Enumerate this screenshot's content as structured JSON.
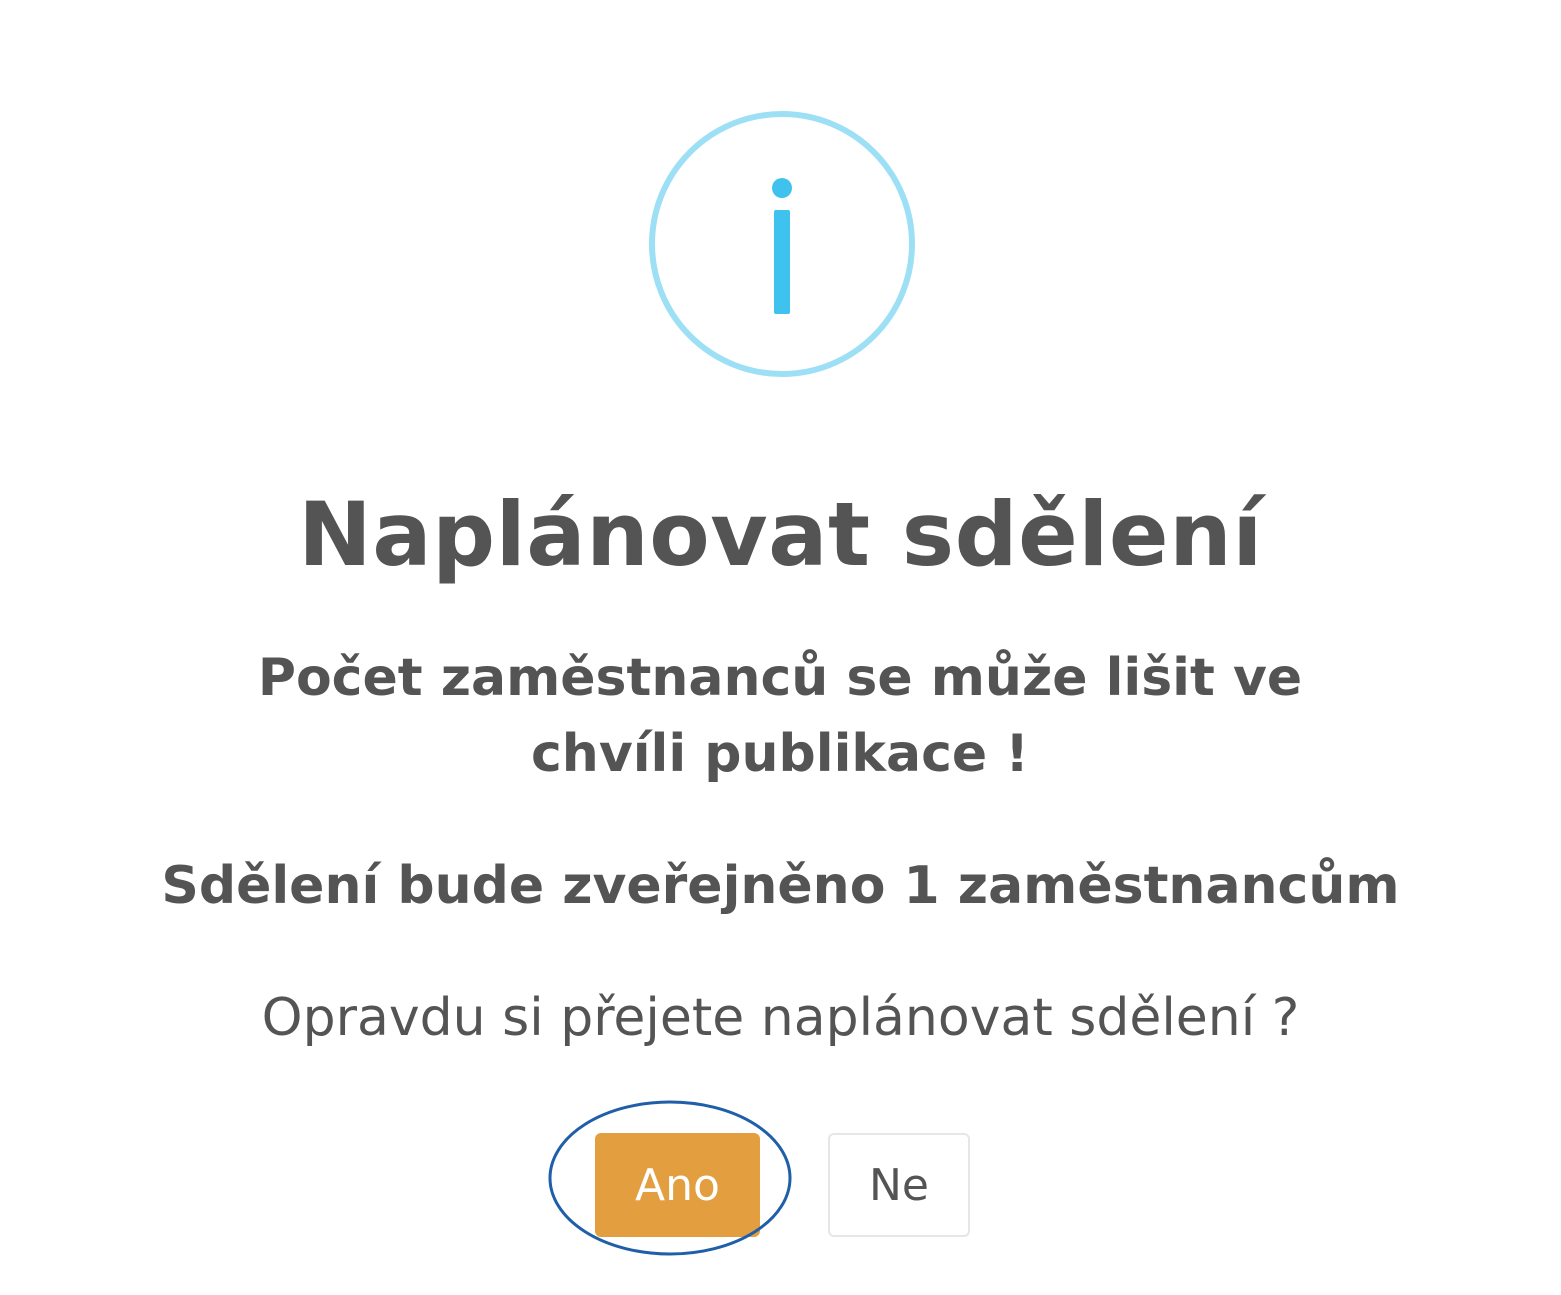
{
  "dialog": {
    "icon": "info-icon",
    "title": "Naplánovat sdělení",
    "warning": "Počet zaměstnanců se může lišit ve chvíli publikace !",
    "count_message": "Sdělení bude zveřejněno 1 zaměstnancům",
    "question": "Opravdu si přejete naplánovat sdělení ?",
    "confirm_label": "Ano",
    "cancel_label": "Ne"
  },
  "colors": {
    "icon": "#3fc3ee",
    "icon_ring": "#9de0f6",
    "text": "#545454",
    "confirm_button": "#e39e3f",
    "highlight_ring": "#1f5ea8"
  }
}
